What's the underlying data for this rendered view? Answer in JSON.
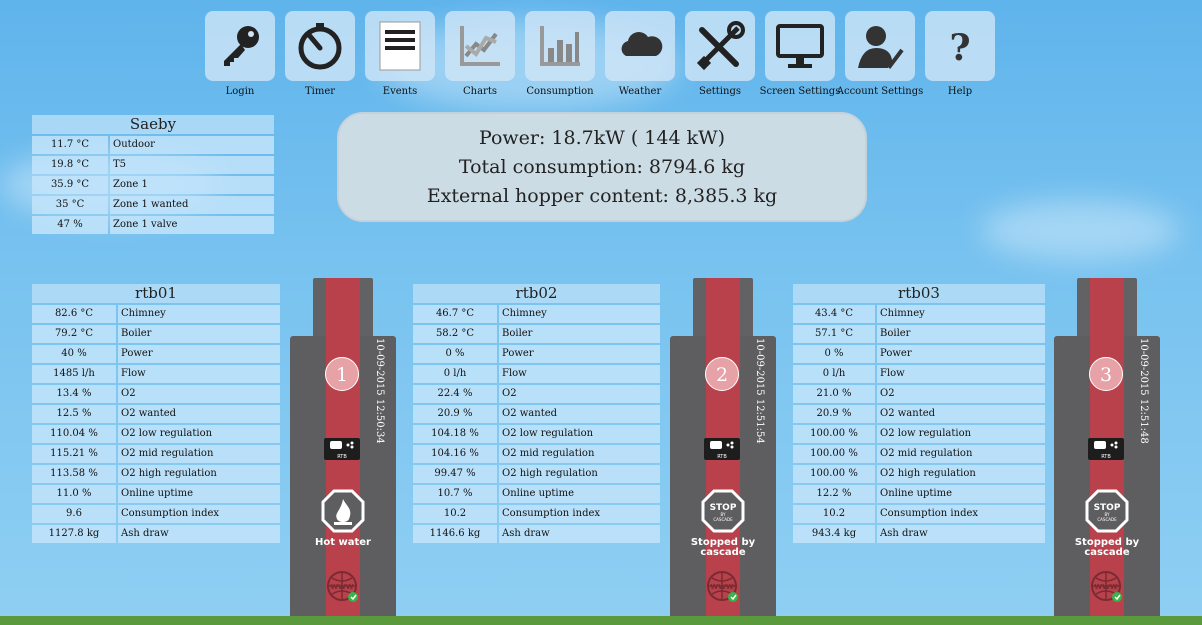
{
  "toolbar": [
    {
      "label": "Login",
      "icon": "key-icon"
    },
    {
      "label": "Timer",
      "icon": "timer-icon"
    },
    {
      "label": "Events",
      "icon": "events-icon"
    },
    {
      "label": "Charts",
      "icon": "charts-icon"
    },
    {
      "label": "Consumption",
      "icon": "consumption-icon"
    },
    {
      "label": "Weather",
      "icon": "cloud-icon"
    },
    {
      "label": "Settings",
      "icon": "tools-icon"
    },
    {
      "label": "Screen Settings",
      "icon": "monitor-icon"
    },
    {
      "label": "Account Settings",
      "icon": "user-check-icon"
    },
    {
      "label": "Help",
      "icon": "question-icon"
    }
  ],
  "site": {
    "title": "Saeby",
    "rows": [
      {
        "value": "11.7 °C",
        "label": "Outdoor"
      },
      {
        "value": "19.8 °C",
        "label": "T5"
      },
      {
        "value": "35.9 °C",
        "label": "Zone 1"
      },
      {
        "value": "35 °C",
        "label": "Zone 1 wanted"
      },
      {
        "value": "47 %",
        "label": "Zone 1 valve"
      }
    ]
  },
  "power_panel": {
    "power": "Power: 18.7kW ( 144 kW)",
    "consumption": "Total consumption: 8794.6 kg",
    "hopper": "External hopper content: 8,385.3 kg"
  },
  "units": [
    {
      "title": "rtb01",
      "number": "1",
      "date": "10-09-2015 12:50:34",
      "status": "Hot water",
      "status_icon": "flame-icon",
      "rows": [
        {
          "value": "82.6 °C",
          "label": "Chimney"
        },
        {
          "value": "79.2 °C",
          "label": "Boiler"
        },
        {
          "value": "40 %",
          "label": "Power"
        },
        {
          "value": "1485 l/h",
          "label": "Flow"
        },
        {
          "value": "13.4 %",
          "label": "O2"
        },
        {
          "value": "12.5 %",
          "label": "O2 wanted"
        },
        {
          "value": "110.04 %",
          "label": "O2 low regulation"
        },
        {
          "value": "115.21 %",
          "label": "O2 mid regulation"
        },
        {
          "value": "113.58 %",
          "label": "O2 high regulation"
        },
        {
          "value": "11.0 %",
          "label": "Online uptime"
        },
        {
          "value": "9.6",
          "label": "Consumption index"
        },
        {
          "value": "1127.8 kg",
          "label": "Ash draw"
        }
      ]
    },
    {
      "title": "rtb02",
      "number": "2",
      "date": "10-09-2015 12:51:54",
      "status": "Stopped by cascade",
      "status_icon": "stop-icon",
      "rows": [
        {
          "value": "46.7 °C",
          "label": "Chimney"
        },
        {
          "value": "58.2 °C",
          "label": "Boiler"
        },
        {
          "value": "0 %",
          "label": "Power"
        },
        {
          "value": "0 l/h",
          "label": "Flow"
        },
        {
          "value": "22.4 %",
          "label": "O2"
        },
        {
          "value": "20.9 %",
          "label": "O2 wanted"
        },
        {
          "value": "104.18 %",
          "label": "O2 low regulation"
        },
        {
          "value": "104.16 %",
          "label": "O2 mid regulation"
        },
        {
          "value": "99.47 %",
          "label": "O2 high regulation"
        },
        {
          "value": "10.7 %",
          "label": "Online uptime"
        },
        {
          "value": "10.2",
          "label": "Consumption index"
        },
        {
          "value": "1146.6 kg",
          "label": "Ash draw"
        }
      ]
    },
    {
      "title": "rtb03",
      "number": "3",
      "date": "10-09-2015 12:51:48",
      "status": "Stopped by cascade",
      "status_icon": "stop-icon",
      "rows": [
        {
          "value": "43.4 °C",
          "label": "Chimney"
        },
        {
          "value": "57.1 °C",
          "label": "Boiler"
        },
        {
          "value": "0 %",
          "label": "Power"
        },
        {
          "value": "0 l/h",
          "label": "Flow"
        },
        {
          "value": "21.0 %",
          "label": "O2"
        },
        {
          "value": "20.9 %",
          "label": "O2 wanted"
        },
        {
          "value": "100.00 %",
          "label": "O2 low regulation"
        },
        {
          "value": "100.00 %",
          "label": "O2 mid regulation"
        },
        {
          "value": "100.00 %",
          "label": "O2 high regulation"
        },
        {
          "value": "12.2 %",
          "label": "Online uptime"
        },
        {
          "value": "10.2",
          "label": "Consumption index"
        },
        {
          "value": "943.4 kg",
          "label": "Ash draw"
        }
      ]
    }
  ],
  "boiler_badges": {
    "rtb": "RTB",
    "stop_word": "STOP",
    "stop_by": "BY",
    "stop_cascade": "CASCADE",
    "web_text": "WWW"
  },
  "colors": {
    "stripe": "#b8414b",
    "body": "#5e5e60",
    "sky": "#79c3f0",
    "ground": "#5a9a3c"
  }
}
